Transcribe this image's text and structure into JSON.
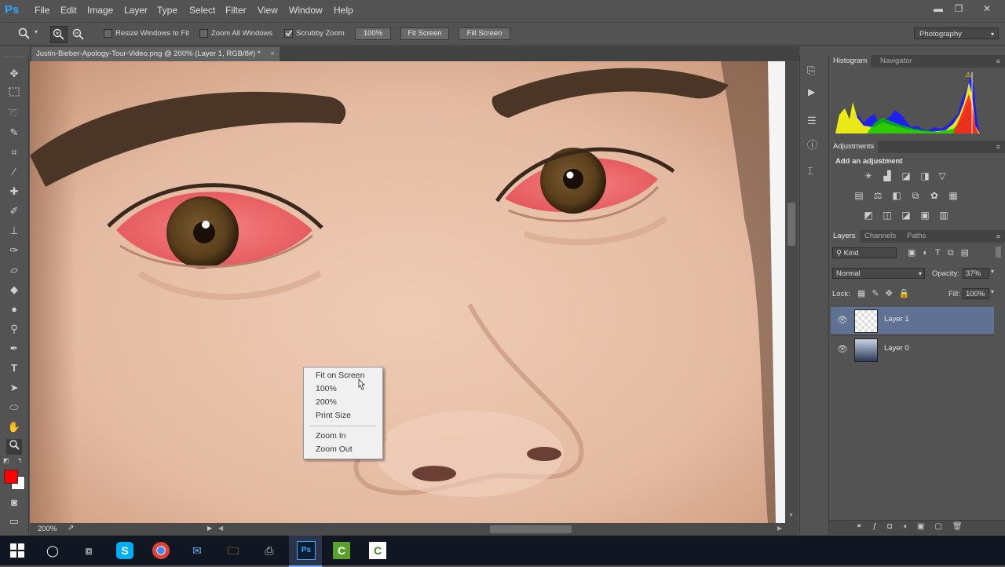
{
  "app": {
    "logo": "Ps"
  },
  "menu": [
    "File",
    "Edit",
    "Image",
    "Layer",
    "Type",
    "Select",
    "Filter",
    "View",
    "Window",
    "Help"
  ],
  "window_controls": {
    "minimize": "▬",
    "restore": "❐",
    "close": "✕"
  },
  "options": {
    "resize_windows": "Resize Windows to Fit",
    "zoom_all": "Zoom All Windows",
    "scrubby": "Scrubby Zoom",
    "btn_100": "100%",
    "btn_fit": "Fit Screen",
    "btn_fill": "Fill Screen",
    "workspace": "Photography"
  },
  "document": {
    "tab_title": "Justin-Bieber-Apology-Tour-Video.png @ 200% (Layer 1, RGB/8#) *",
    "close": "×"
  },
  "status": {
    "zoom": "200%"
  },
  "panels": {
    "histogram_tab": "Histogram",
    "navigator_tab": "Navigator",
    "adjustments_tab": "Adjustments",
    "add_adjustment": "Add an adjustment",
    "layers_tab": "Layers",
    "channels_tab": "Channels",
    "paths_tab": "Paths",
    "kind": "Kind",
    "blend_mode": "Normal",
    "opacity_label": "Opacity:",
    "opacity_value": "37%",
    "lock_label": "Lock:",
    "fill_label": "Fill:",
    "fill_value": "100%"
  },
  "layers": [
    {
      "name": "Layer 1",
      "selected": true
    },
    {
      "name": "Layer 0",
      "selected": false
    }
  ],
  "context_menu": {
    "items": [
      "Fit on Screen",
      "100%",
      "200%",
      "Print Size"
    ],
    "items2": [
      "Zoom In",
      "Zoom Out"
    ]
  },
  "colors": {
    "foreground": "#ff0000",
    "background": "#ffffff",
    "accent": "#31a8ff"
  }
}
